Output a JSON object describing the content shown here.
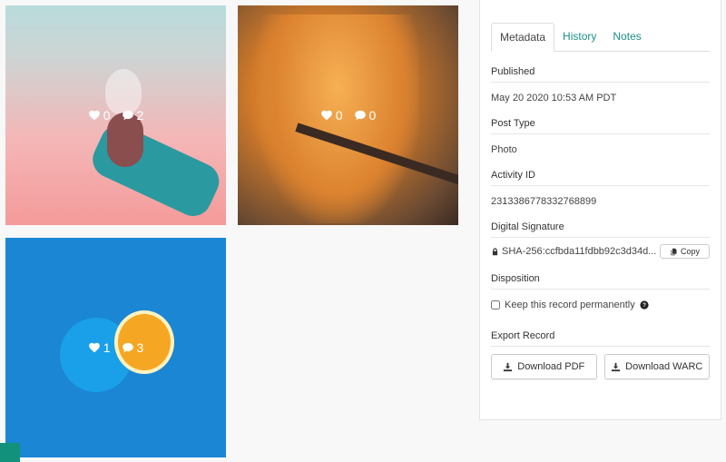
{
  "posts": [
    {
      "likes": "0",
      "comments": "2"
    },
    {
      "likes": "0",
      "comments": "0"
    },
    {
      "likes": "1",
      "comments": "3"
    }
  ],
  "panel": {
    "tabs": [
      {
        "label": "Metadata",
        "active": true
      },
      {
        "label": "History",
        "active": false
      },
      {
        "label": "Notes",
        "active": false
      }
    ],
    "published": {
      "label": "Published",
      "value": "May 20 2020 10:53 AM PDT"
    },
    "post_type": {
      "label": "Post Type",
      "value": "Photo"
    },
    "activity_id": {
      "label": "Activity ID",
      "value": "2313386778332768899"
    },
    "digital_signature": {
      "label": "Digital Signature",
      "value": "SHA-256:ccfbda11fdbb92c3d34d...",
      "copy_label": "Copy"
    },
    "disposition": {
      "label": "Disposition",
      "checkbox_label": "Keep this record permanently",
      "checked": false
    },
    "export": {
      "label": "Export Record",
      "pdf_label": "Download PDF",
      "warc_label": "Download WARC"
    }
  },
  "colors": {
    "accent": "#1d8f8a",
    "corner": "#12927a"
  }
}
